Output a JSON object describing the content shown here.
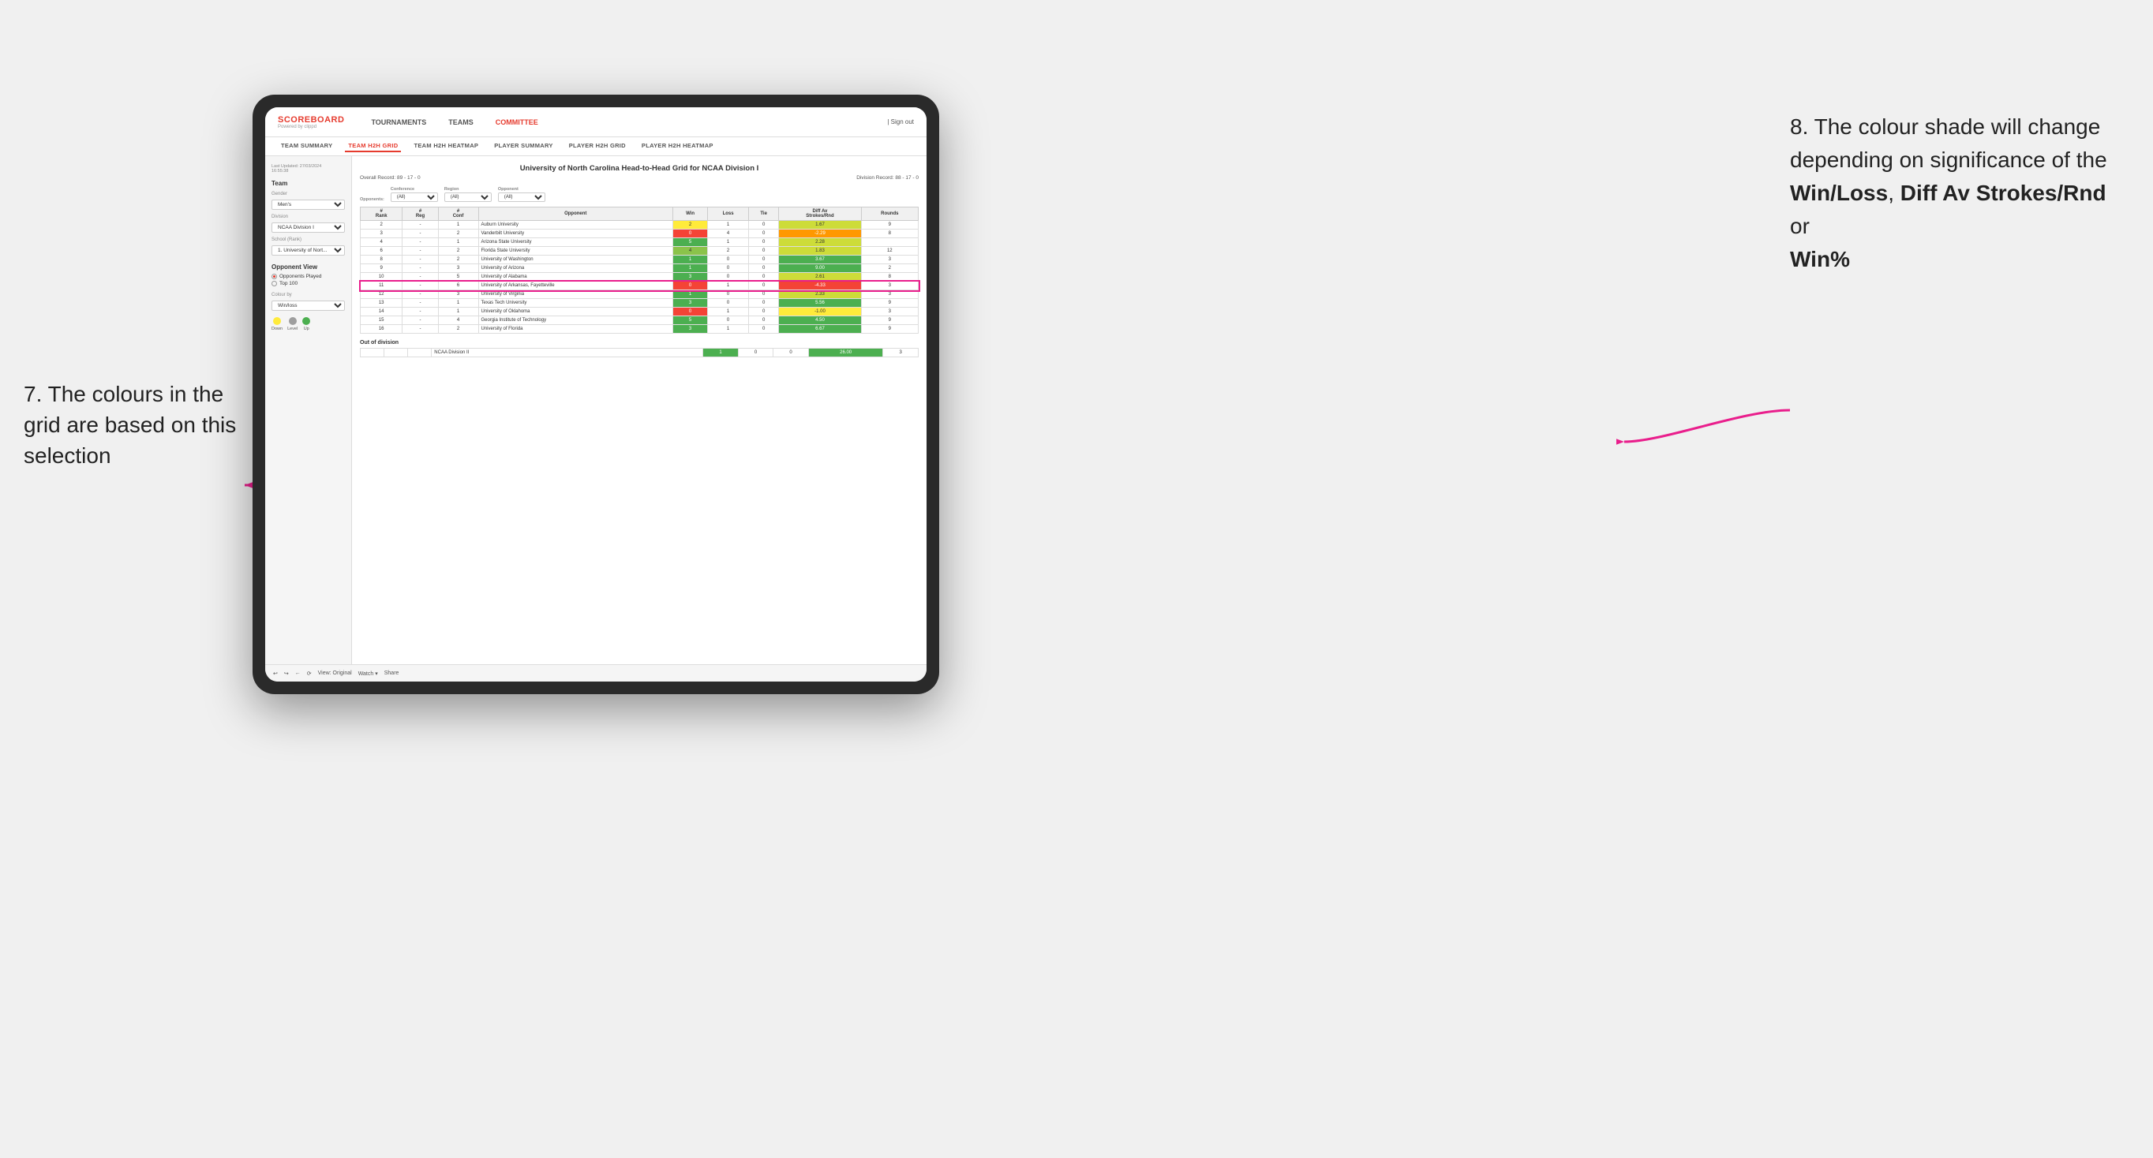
{
  "annotations": {
    "left_title": "7. The colours in the grid are based on this selection",
    "right_title": "8. The colour shade will change depending on significance of the",
    "right_bold1": "Win/Loss",
    "right_comma": ", ",
    "right_bold2": "Diff Av Strokes/Rnd",
    "right_or": " or",
    "right_bold3": "Win%"
  },
  "nav": {
    "logo": "SCOREBOARD",
    "logo_sub": "Powered by clippd",
    "items": [
      "TOURNAMENTS",
      "TEAMS",
      "COMMITTEE"
    ],
    "sign_out": "Sign out"
  },
  "sub_nav": {
    "items": [
      "TEAM SUMMARY",
      "TEAM H2H GRID",
      "TEAM H2H HEATMAP",
      "PLAYER SUMMARY",
      "PLAYER H2H GRID",
      "PLAYER H2H HEATMAP"
    ],
    "active": "TEAM H2H GRID"
  },
  "left_panel": {
    "last_updated_label": "Last Updated: 27/03/2024",
    "last_updated_time": "16:55:38",
    "team_label": "Team",
    "gender_label": "Gender",
    "gender_value": "Men's",
    "division_label": "Division",
    "division_value": "NCAA Division I",
    "school_label": "School (Rank)",
    "school_value": "1. University of Nort...",
    "opponent_view_label": "Opponent View",
    "radio_opponents": "Opponents Played",
    "radio_top100": "Top 100",
    "colour_by_label": "Colour by",
    "colour_by_value": "Win/loss",
    "legend_down": "Down",
    "legend_level": "Level",
    "legend_up": "Up"
  },
  "grid": {
    "title": "University of North Carolina Head-to-Head Grid for NCAA Division I",
    "overall_record": "Overall Record: 89 - 17 - 0",
    "division_record": "Division Record: 88 - 17 - 0",
    "filter_opponents_label": "Opponents:",
    "filter_conference_label": "Conference",
    "filter_region_label": "Region",
    "filter_opponent_label": "Opponent",
    "filter_all": "(All)",
    "headers": [
      "#\nRank",
      "#\nReg",
      "#\nConf",
      "Opponent",
      "Win",
      "Loss",
      "Tie",
      "Diff Av\nStrokes/Rnd",
      "Rounds"
    ],
    "rows": [
      {
        "rank": "2",
        "reg": "-",
        "conf": "1",
        "name": "Auburn University",
        "win": "2",
        "loss": "1",
        "tie": "0",
        "diff": "1.67",
        "rounds": "9",
        "win_color": "yellow",
        "diff_color": "green_light"
      },
      {
        "rank": "3",
        "reg": "-",
        "conf": "2",
        "name": "Vanderbilt University",
        "win": "0",
        "loss": "4",
        "tie": "0",
        "diff": "-2.29",
        "rounds": "8",
        "win_color": "red",
        "diff_color": "orange"
      },
      {
        "rank": "4",
        "reg": "-",
        "conf": "1",
        "name": "Arizona State University",
        "win": "5",
        "loss": "1",
        "tie": "0",
        "diff": "2.28",
        "rounds": "",
        "win_color": "green_dark",
        "diff_color": "green_light"
      },
      {
        "rank": "6",
        "reg": "-",
        "conf": "2",
        "name": "Florida State University",
        "win": "4",
        "loss": "2",
        "tie": "0",
        "diff": "1.83",
        "rounds": "12",
        "win_color": "green_med",
        "diff_color": "green_light"
      },
      {
        "rank": "8",
        "reg": "-",
        "conf": "2",
        "name": "University of Washington",
        "win": "1",
        "loss": "0",
        "tie": "0",
        "diff": "3.67",
        "rounds": "3",
        "win_color": "green_dark",
        "diff_color": "green_dark"
      },
      {
        "rank": "9",
        "reg": "-",
        "conf": "3",
        "name": "University of Arizona",
        "win": "1",
        "loss": "0",
        "tie": "0",
        "diff": "9.00",
        "rounds": "2",
        "win_color": "green_dark",
        "diff_color": "green_dark"
      },
      {
        "rank": "10",
        "reg": "-",
        "conf": "5",
        "name": "University of Alabama",
        "win": "3",
        "loss": "0",
        "tie": "0",
        "diff": "2.61",
        "rounds": "8",
        "win_color": "green_dark",
        "diff_color": "green_light"
      },
      {
        "rank": "11",
        "reg": "-",
        "conf": "6",
        "name": "University of Arkansas, Fayetteville",
        "win": "0",
        "loss": "1",
        "tie": "0",
        "diff": "-4.33",
        "rounds": "3",
        "win_color": "red",
        "diff_color": "red",
        "highlighted": true
      },
      {
        "rank": "12",
        "reg": "-",
        "conf": "3",
        "name": "University of Virginia",
        "win": "1",
        "loss": "0",
        "tie": "0",
        "diff": "2.33",
        "rounds": "3",
        "win_color": "green_dark",
        "diff_color": "green_light"
      },
      {
        "rank": "13",
        "reg": "-",
        "conf": "1",
        "name": "Texas Tech University",
        "win": "3",
        "loss": "0",
        "tie": "0",
        "diff": "5.56",
        "rounds": "9",
        "win_color": "green_dark",
        "diff_color": "green_dark"
      },
      {
        "rank": "14",
        "reg": "-",
        "conf": "1",
        "name": "University of Oklahoma",
        "win": "0",
        "loss": "1",
        "tie": "0",
        "diff": "-1.00",
        "rounds": "3",
        "win_color": "red",
        "diff_color": "yellow"
      },
      {
        "rank": "15",
        "reg": "-",
        "conf": "4",
        "name": "Georgia Institute of Technology",
        "win": "5",
        "loss": "0",
        "tie": "0",
        "diff": "4.50",
        "rounds": "9",
        "win_color": "green_dark",
        "diff_color": "green_dark"
      },
      {
        "rank": "16",
        "reg": "-",
        "conf": "2",
        "name": "University of Florida",
        "win": "3",
        "loss": "1",
        "tie": "0",
        "diff": "6.67",
        "rounds": "9",
        "win_color": "green_dark",
        "diff_color": "green_dark"
      }
    ],
    "out_of_division_label": "Out of division",
    "out_of_division_rows": [
      {
        "name": "NCAA Division II",
        "win": "1",
        "loss": "0",
        "tie": "0",
        "diff": "26.00",
        "rounds": "3",
        "win_color": "green_dark",
        "diff_color": "green_dark"
      }
    ]
  },
  "toolbar": {
    "view_label": "View: Original",
    "watch_label": "Watch ▾",
    "share_label": "Share"
  },
  "colors": {
    "green_dark": "#4caf50",
    "green_med": "#8bc34a",
    "green_light": "#cddc39",
    "yellow": "#ffeb3b",
    "orange": "#ff9800",
    "red": "#f44336",
    "accent": "#e63b2e",
    "pink_arrow": "#e91e8c"
  }
}
